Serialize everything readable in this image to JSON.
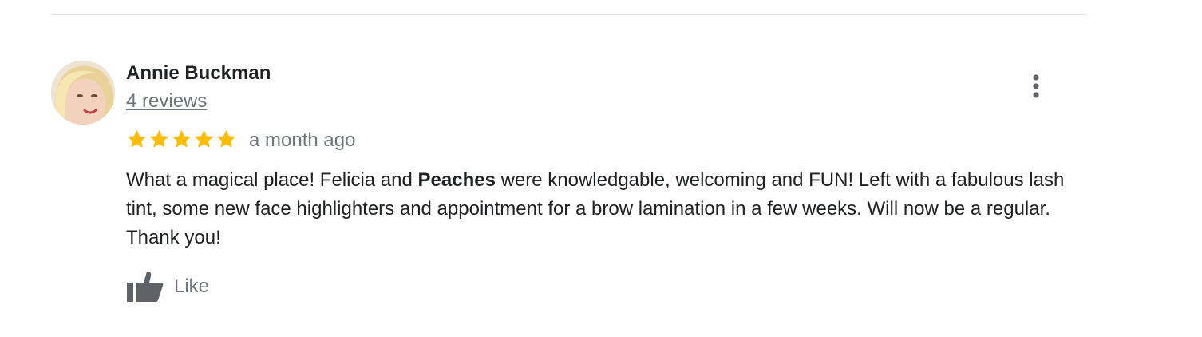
{
  "review": {
    "author": {
      "name": "Annie Buckman",
      "reviews_link": "4 reviews"
    },
    "rating": 5,
    "rating_max": 5,
    "date": "a month ago",
    "text_before": "What a magical place! Felicia and ",
    "text_bold": "Peaches",
    "text_after": " were knowledgable, welcoming and FUN! Left with a fabulous lash tint, some new face highlighters and appointment for a brow lamination in a few weeks. Will now be a regular. Thank you!",
    "like_label": "Like"
  },
  "icons": {
    "menu": "more-vertical-icon",
    "star": "star-icon",
    "like": "thumbs-up-icon"
  },
  "colors": {
    "star": "#fbbc04",
    "secondary_text": "#70757a",
    "primary_text": "#202124",
    "divider": "#e0e0e0"
  }
}
